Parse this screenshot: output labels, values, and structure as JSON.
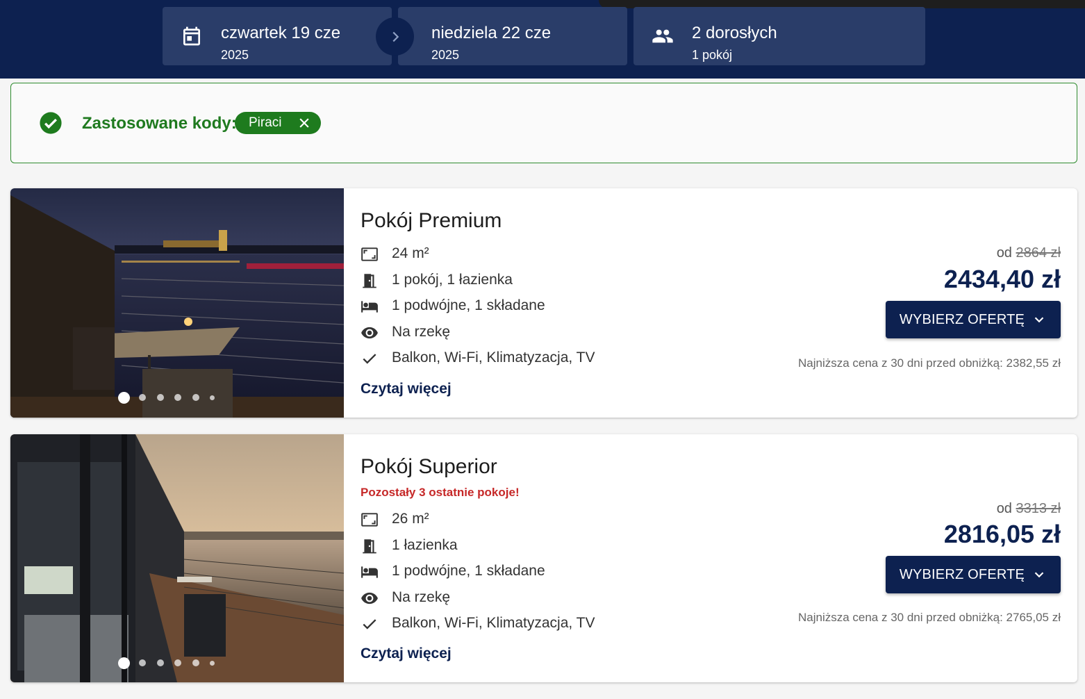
{
  "search": {
    "checkin": {
      "day": "czwartek 19 cze",
      "year": "2025"
    },
    "checkout": {
      "day": "niedziela 22 cze",
      "year": "2025"
    },
    "guests": {
      "adults": "2 dorosłych",
      "rooms": "1 pokój"
    }
  },
  "codes": {
    "label": "Zastosowane kody:",
    "applied": "Piraci"
  },
  "rooms": [
    {
      "name": "Pokój Premium",
      "alert": "",
      "features": [
        {
          "icon": "area-icon",
          "text": "24 m²"
        },
        {
          "icon": "door-icon",
          "text": "1 pokój, 1 łazienka"
        },
        {
          "icon": "bed-icon",
          "text": "1 podwójne, 1 składane"
        },
        {
          "icon": "eye-icon",
          "text": "Na rzekę"
        },
        {
          "icon": "check-icon",
          "text": "Balkon, Wi-Fi, Klimatyzacja, TV"
        }
      ],
      "read_more": "Czytaj więcej",
      "price_prefix": "od",
      "price_old": "2864 zł",
      "price": "2434,40 zł",
      "button": "WYBIERZ OFERTĘ",
      "lowest_price": "Najniższa cena z 30 dni przed obniżką: 2382,55 zł",
      "photo_count": 6
    },
    {
      "name": "Pokój Superior",
      "alert": "Pozostały 3 ostatnie pokoje!",
      "features": [
        {
          "icon": "area-icon",
          "text": "26 m²"
        },
        {
          "icon": "door-icon",
          "text": "1 łazienka"
        },
        {
          "icon": "bed-icon",
          "text": "1 podwójne, 1 składane"
        },
        {
          "icon": "eye-icon",
          "text": "Na rzekę"
        },
        {
          "icon": "check-icon",
          "text": "Balkon, Wi-Fi, Klimatyzacja, TV"
        }
      ],
      "read_more": "Czytaj więcej",
      "price_prefix": "od",
      "price_old": "3313 zł",
      "price": "2816,05 zł",
      "button": "WYBIERZ OFERTĘ",
      "lowest_price": "Najniższa cena z 30 dni przed obniżką: 2765,05 zł",
      "photo_count": 6
    }
  ],
  "colors": {
    "header_bg": "#0d2150",
    "pill_bg": "#2a3d69",
    "success_green": "#1e7b1e",
    "alert_red": "#c62828"
  }
}
